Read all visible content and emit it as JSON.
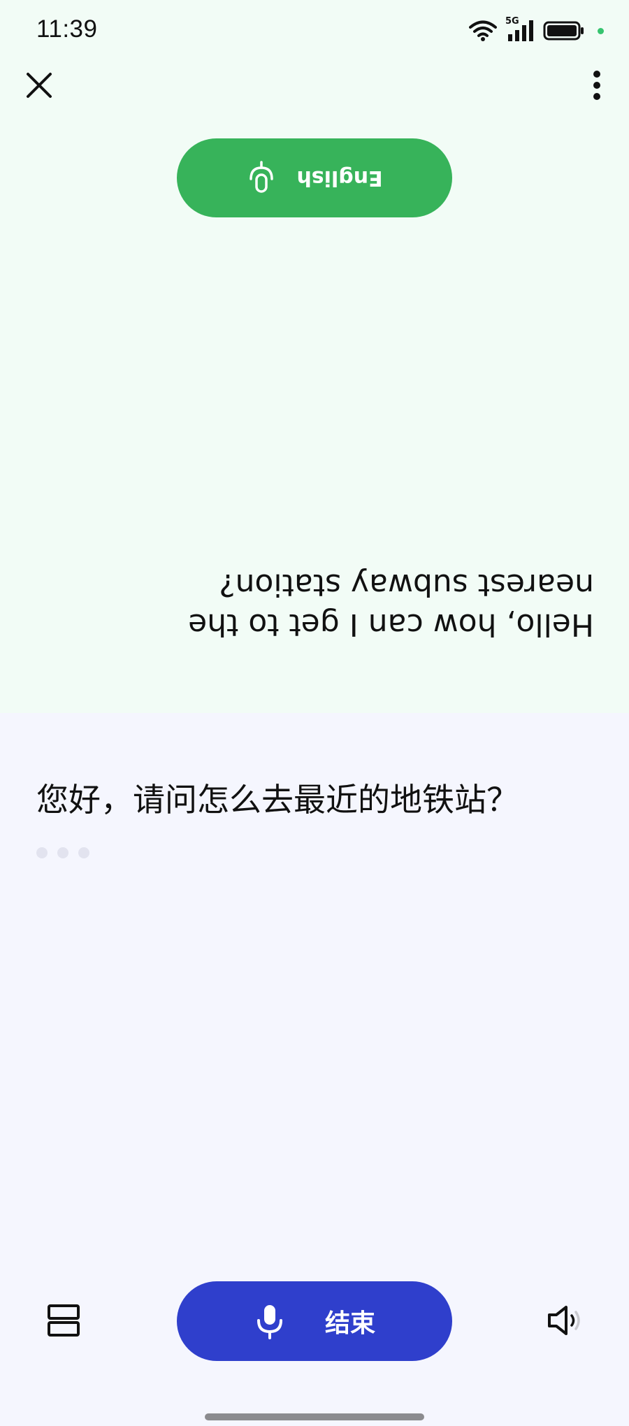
{
  "status_bar": {
    "time": "11:39",
    "network": "5G",
    "icons": [
      "wifi-icon",
      "signal-5g-icon",
      "battery-icon"
    ],
    "indicator_color": "#36c46f"
  },
  "top_panel": {
    "language_label": "English",
    "source_text": "Hello, how can I get to the nearest subway station?",
    "pill_color": "#37b35a",
    "background": "#f2fcf6"
  },
  "bottom_panel": {
    "translated_text": "您好，请问怎么去最近的地铁站？",
    "end_button_label": "结束",
    "pill_color": "#2f3fcc",
    "background": "#f5f6fe"
  },
  "controls": {
    "close": "close-icon",
    "more": "more-vertical-icon",
    "layout": "split-layout-icon",
    "speaker": "speaker-icon"
  }
}
